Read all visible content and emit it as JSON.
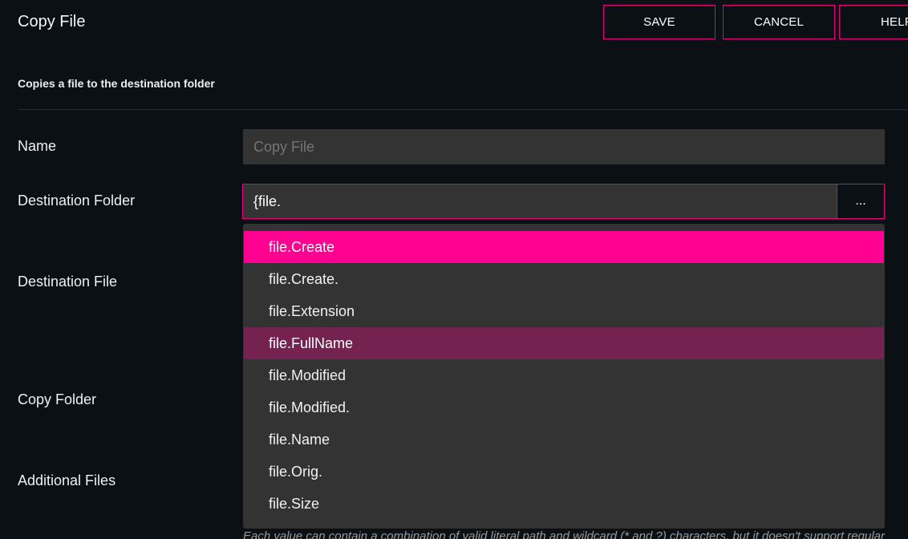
{
  "header": {
    "title": "Copy File",
    "buttons": {
      "save": "SAVE",
      "cancel": "CANCEL",
      "help": "HELP"
    }
  },
  "description": "Copies a file to the destination folder",
  "form": {
    "name": {
      "label": "Name",
      "placeholder": "Copy File"
    },
    "destination_folder": {
      "label": "Destination Folder",
      "value": "{file.",
      "browse_label": "..."
    },
    "destination_file": {
      "label": "Destination File"
    },
    "copy_folder": {
      "label": "Copy Folder"
    },
    "additional_files": {
      "label": "Additional Files"
    }
  },
  "autocomplete": {
    "items": [
      "file.Create",
      "file.Create.",
      "file.Extension",
      "file.FullName",
      "file.Modified",
      "file.Modified.",
      "file.Name",
      "file.Orig.",
      "file.Size"
    ],
    "selected": "file.Create",
    "hovered": "file.FullName"
  },
  "hint_text": "Each value can contain a combination of valid literal path and wildcard (* and ?) characters, but it doesn't support regular",
  "colors": {
    "accent": "#e7007d",
    "selected_item": "#ff0090",
    "hovered_item": "#74224f",
    "background": "#0a1014",
    "input_background": "#333333"
  }
}
